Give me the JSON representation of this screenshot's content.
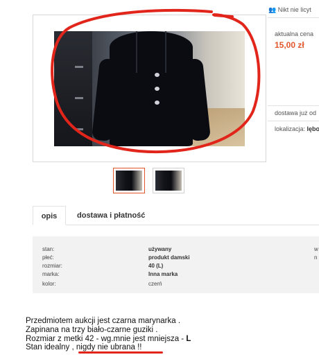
{
  "right_column": {
    "bidders_text": "Nikt nie licyt",
    "price_label": "aktualna cena",
    "price": "15,00 zł",
    "delivery_text": "dostawa już od",
    "location_label": "lokalizacja:",
    "location_value": "lębo"
  },
  "tabs": [
    {
      "label": "opis",
      "active": true
    },
    {
      "label": "dostawa i płatność",
      "active": false
    }
  ],
  "details": {
    "rows": [
      {
        "label": "stan:",
        "value": "używany"
      },
      {
        "label": "płeć:",
        "value": "produkt damski"
      },
      {
        "label": "rozmiar:",
        "value": "40 (L)"
      },
      {
        "label": "marka:",
        "value": "Inna marka"
      },
      {
        "label": "kolor:",
        "value": "czerń"
      }
    ],
    "extra_right_1": "w",
    "extra_right_2": "n"
  },
  "description": {
    "line1": "Przedmiotem aukcji jest czarna marynarka .",
    "line2": "Zapinana na trzy biało-czarne guziki .",
    "line3_prefix": "Rozmiar z metki 42 - wg.mnie jest mniejsza - ",
    "line3_bold": "L",
    "line4": "Stan idealny , nigdy nie ubrana !!"
  },
  "colors": {
    "accent": "#e2552a",
    "annotation": "#e1251b"
  },
  "icons": {
    "bidders": "people-icon"
  }
}
